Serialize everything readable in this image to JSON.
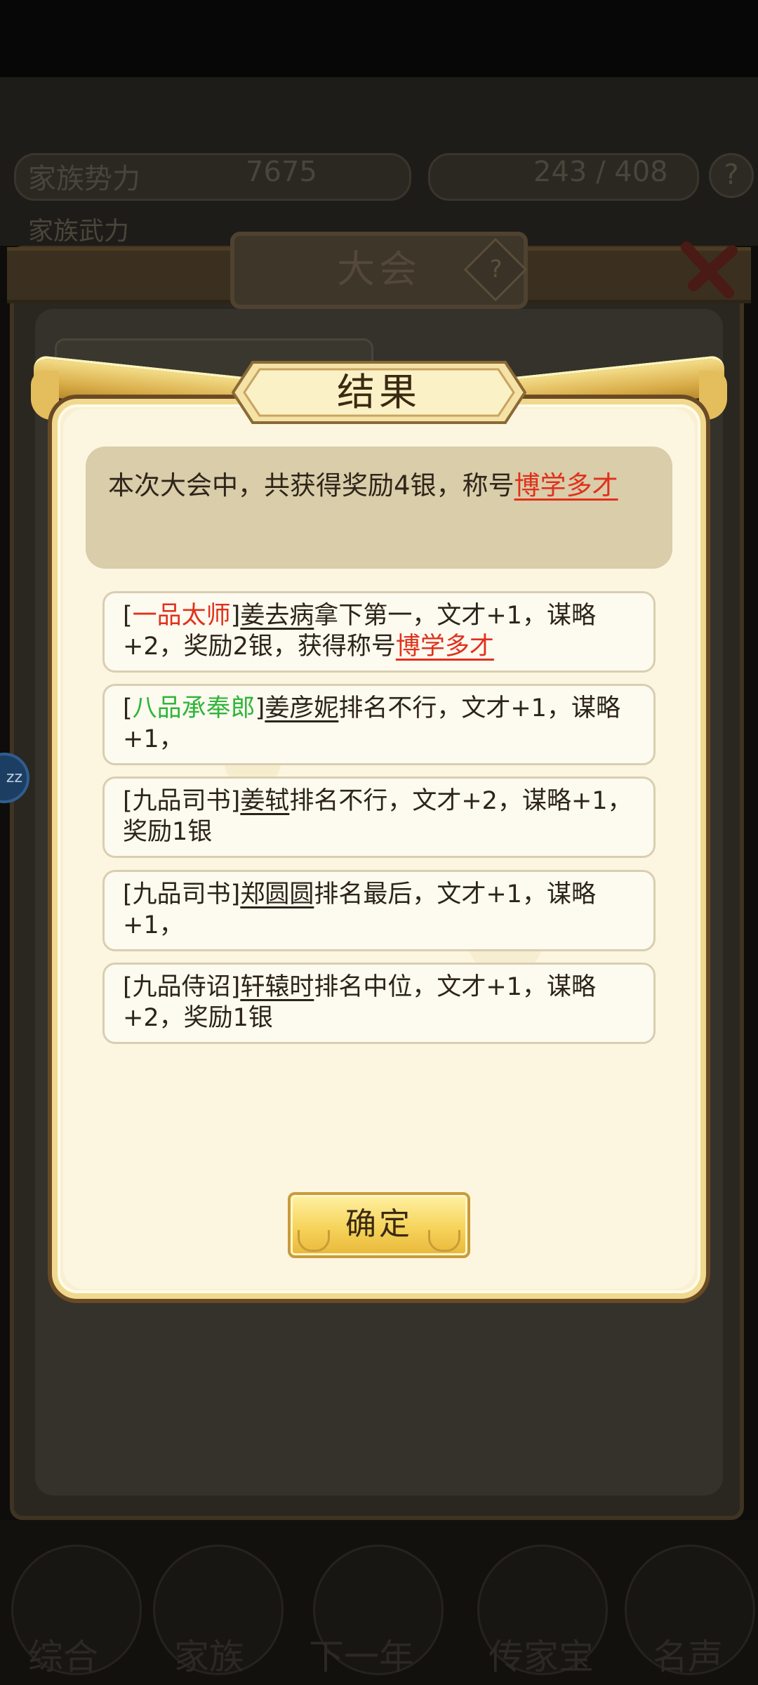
{
  "background": {
    "hud_left_label": "家族势力",
    "hud_left_value": "7675",
    "hud_right_value": "243 / 408",
    "hud_second_label": "家族武力",
    "window_title": "大会",
    "help_symbol": "?",
    "nav_items": [
      "综合",
      "家族",
      "下一年",
      "传家宝",
      "名声"
    ],
    "side_bubble": "zz"
  },
  "dialog": {
    "title": "结果",
    "summary_prefix": "本次大会中，共获得奖励4银，称号",
    "summary_title": "博学多才",
    "results": [
      {
        "rank": "一品太师",
        "rank_color": "#e0311c",
        "name": "姜去病",
        "text": "拿下第一，文才+1，谋略+2，奖励2银，获得称号",
        "title": "博学多才"
      },
      {
        "rank": "八品承奉郎",
        "rank_color": "#2fb53a",
        "name": "姜彦妮",
        "text": "排名不行，文才+1，谋略+1，",
        "title": ""
      },
      {
        "rank": "九品司书",
        "rank_color": "#2c2418",
        "name": "姜轼",
        "text": "排名不行，文才+2，谋略+1，奖励1银",
        "title": ""
      },
      {
        "rank": "九品司书",
        "rank_color": "#2c2418",
        "name": "郑圆圆",
        "text": "排名最后，文才+1，谋略+1，",
        "title": ""
      },
      {
        "rank": "九品侍诏",
        "rank_color": "#2c2418",
        "name": "轩辕时",
        "text": "排名中位，文才+1，谋略+2，奖励1银",
        "title": ""
      }
    ],
    "confirm_label": "确定"
  }
}
